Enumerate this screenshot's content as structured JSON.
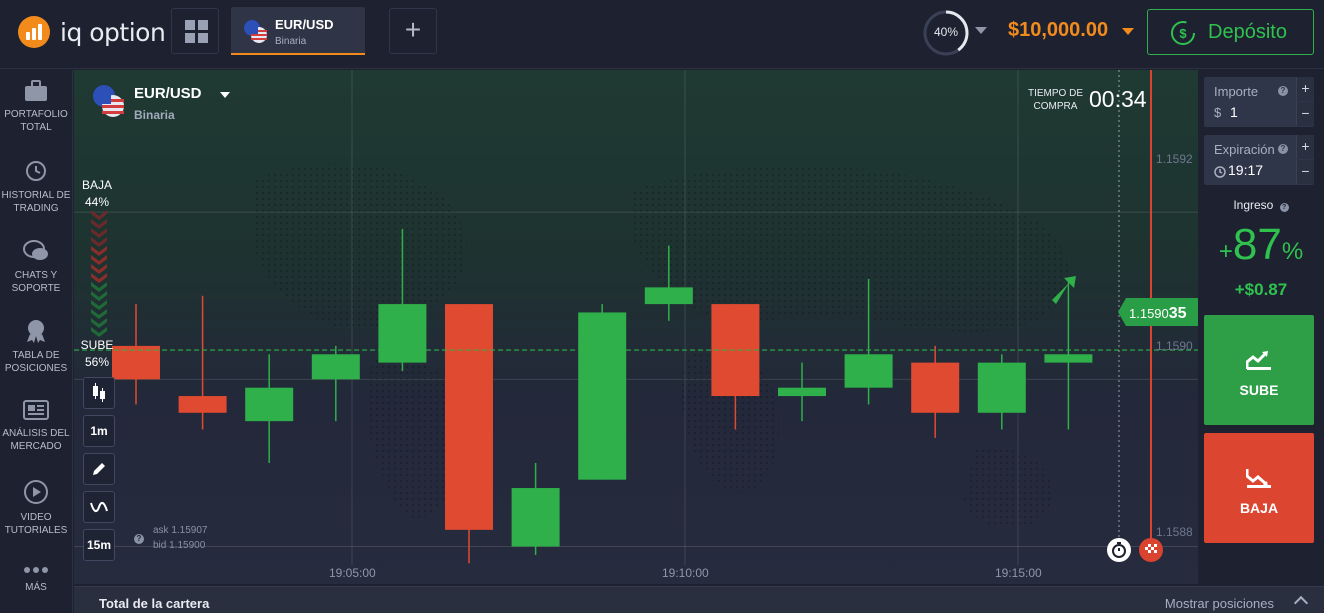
{
  "header": {
    "logo_text": "iq option",
    "asset_tab": {
      "pair": "EUR/USD",
      "kind": "Binaria"
    },
    "profit_ring": {
      "label": "40%",
      "value": 0.4
    },
    "balance": "$10,000.00",
    "deposit_label": "Depósito"
  },
  "sidebar": {
    "items": [
      {
        "label": "PORTAFOLIO TOTAL",
        "icon": "briefcase-icon"
      },
      {
        "label": "HISTORIAL DE TRADING",
        "icon": "history-icon"
      },
      {
        "label": "CHATS Y SOPORTE",
        "icon": "chat-icon"
      },
      {
        "label": "TABLA DE POSICIONES",
        "icon": "trophy-icon"
      },
      {
        "label": "ANÁLISIS DEL MERCADO",
        "icon": "news-icon"
      },
      {
        "label": "VIDEO TUTORIALES",
        "icon": "play-icon"
      },
      {
        "label": "MÁS",
        "icon": "more-dots-icon"
      }
    ]
  },
  "chart_header": {
    "pair": "EUR/USD",
    "kind": "Binaria"
  },
  "sentiment": {
    "down_label": "BAJA",
    "down_pct": "44%",
    "up_label": "SUBE",
    "up_pct": "56%"
  },
  "tools": {
    "timeframe": "1m",
    "interval": "15m"
  },
  "quote": {
    "ask": "ask 1.15907",
    "bid": "bid 1.15900"
  },
  "purchase_time": {
    "label_line1": "TIEMPO DE",
    "label_line2": "COMPRA",
    "countdown": "00:34"
  },
  "current_price": {
    "main": "1.1590",
    "last": "35"
  },
  "colors": {
    "up": "#2fb04a",
    "down": "#e04a30",
    "accent": "#f28a1c"
  },
  "chart_data": {
    "type": "candlestick",
    "x_ticks": [
      "19:05:00",
      "19:10:00",
      "19:15:00"
    ],
    "y_ticks": [
      "1.1592",
      "1.1590",
      "1.1588"
    ],
    "ylim": [
      1.15876,
      1.15937
    ],
    "current_price": 1.159035,
    "candles": [
      {
        "o": 1.15904,
        "h": 1.15909,
        "l": 1.15897,
        "c": 1.159
      },
      {
        "o": 1.15898,
        "h": 1.1591,
        "l": 1.15894,
        "c": 1.15896
      },
      {
        "o": 1.15895,
        "h": 1.15903,
        "l": 1.1589,
        "c": 1.15899
      },
      {
        "o": 1.159,
        "h": 1.15904,
        "l": 1.15895,
        "c": 1.15903
      },
      {
        "o": 1.15902,
        "h": 1.15918,
        "l": 1.15901,
        "c": 1.15909
      },
      {
        "o": 1.15909,
        "h": 1.15909,
        "l": 1.15878,
        "c": 1.15882
      },
      {
        "o": 1.1588,
        "h": 1.1589,
        "l": 1.15879,
        "c": 1.15887
      },
      {
        "o": 1.15888,
        "h": 1.15909,
        "l": 1.15888,
        "c": 1.15908
      },
      {
        "o": 1.15909,
        "h": 1.15916,
        "l": 1.15907,
        "c": 1.15911
      },
      {
        "o": 1.15909,
        "h": 1.15909,
        "l": 1.15894,
        "c": 1.15898
      },
      {
        "o": 1.15898,
        "h": 1.15902,
        "l": 1.15895,
        "c": 1.15899
      },
      {
        "o": 1.15899,
        "h": 1.15912,
        "l": 1.15897,
        "c": 1.15903
      },
      {
        "o": 1.15902,
        "h": 1.15904,
        "l": 1.15893,
        "c": 1.15896
      },
      {
        "o": 1.15896,
        "h": 1.15903,
        "l": 1.15894,
        "c": 1.15902
      },
      {
        "o": 1.15902,
        "h": 1.15912,
        "l": 1.15894,
        "c": 1.15903
      }
    ]
  },
  "trade_panel": {
    "amount": {
      "label": "Importe",
      "currency": "$",
      "value": "1"
    },
    "expiration": {
      "label": "Expiración",
      "value": "19:17"
    },
    "income": {
      "label": "Ingreso",
      "plus": "+",
      "value": "87",
      "pct": "%",
      "amount": "+$0.87"
    },
    "up_label": "SUBE",
    "down_label": "BAJA"
  },
  "bottom_bar": {
    "portfolio_total": "Total de la cartera",
    "show_positions": "Mostrar posiciones"
  }
}
